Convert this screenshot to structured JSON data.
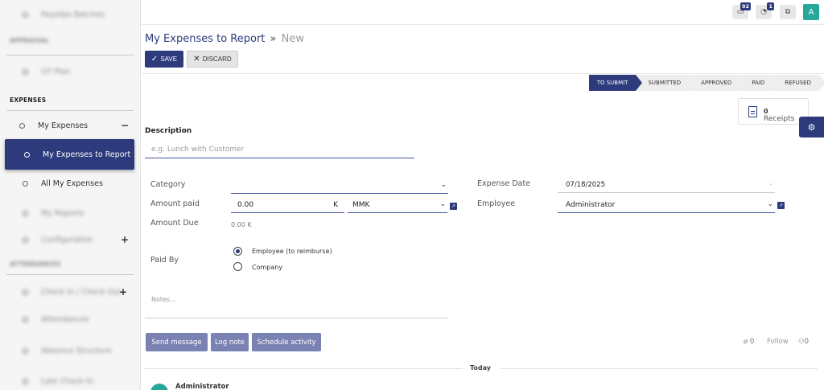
{
  "sidebar": {
    "blurred_top_1": "Payslips Batches",
    "blurred_section_1": "APPRAISAL",
    "blurred_item_2": "OT Plan",
    "section_expenses": "EXPENSES",
    "my_expenses": "My Expenses",
    "my_expenses_sign": "−",
    "active_item": "My Expenses to Report",
    "all_my_expenses": "All My Expenses",
    "blurred_reports": "My Reports",
    "blurred_config": "Configuration",
    "config_sign": "+",
    "blurred_section_att": "ATTENDANCES",
    "blurred_checkin": "Check In / Check Out",
    "checkin_sign": "+",
    "blurred_att": "Attendances",
    "blurred_absence": "Absence Structure",
    "blurred_late": "Late Check-In"
  },
  "topbar": {
    "messages_badge": "92",
    "activity_badge": "1",
    "avatar_letter": "A"
  },
  "breadcrumb": {
    "parent": "My Expenses to Report",
    "separator": "»",
    "current": "New"
  },
  "actions": {
    "save": "SAVE",
    "discard": "DISCARD"
  },
  "stages": [
    "TO SUBMIT",
    "SUBMITTED",
    "APPROVED",
    "PAID",
    "REFUSED"
  ],
  "receipts": {
    "count": "0",
    "label": "Receipts"
  },
  "form": {
    "description_label": "Description",
    "description_placeholder": "e.g. Lunch with Customer",
    "category_label": "Category",
    "category_value": "",
    "amount_paid_label": "Amount paid",
    "amount_paid_value": "0.00",
    "amount_suffix": "K",
    "currency_value": "MMK",
    "amount_due_label": "Amount Due",
    "amount_due_value": "0.00 K",
    "expense_date_label": "Expense Date",
    "expense_date_value": "07/18/2025",
    "employee_label": "Employee",
    "employee_value": "Administrator",
    "paid_by_label": "Paid By",
    "paid_by_options": [
      "Employee (to reimburse)",
      "Company"
    ],
    "paid_by_selected": "Employee (to reimburse)",
    "notes_placeholder": "Notes..."
  },
  "chatter": {
    "send_message": "Send message",
    "log_note": "Log note",
    "schedule_activity": "Schedule activity",
    "attachments_count": "0",
    "follow": "Follow",
    "followers_count": "0",
    "today": "Today",
    "author": "Administrator"
  },
  "colors": {
    "primary": "#2d3a7c",
    "chatter_button": "#7a81b3",
    "avatar": "#27a69a"
  }
}
